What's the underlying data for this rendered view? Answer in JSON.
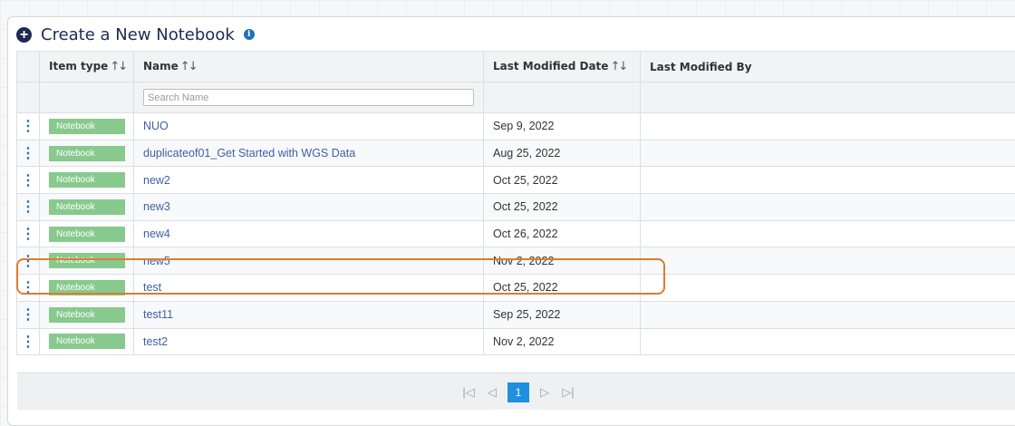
{
  "header": {
    "title": "Create a New Notebook",
    "add_icon": "plus-circle-icon",
    "info_icon": "info-icon"
  },
  "table": {
    "columns": [
      {
        "label": "Item type",
        "sortable": true
      },
      {
        "label": "Name",
        "sortable": true
      },
      {
        "label": "Last Modified Date",
        "sortable": true
      },
      {
        "label": "Last Modified By",
        "sortable": false
      }
    ],
    "search": {
      "placeholder": "Search Name",
      "value": ""
    },
    "rows": [
      {
        "type": "Notebook",
        "name": "NUO",
        "date": "Sep 9, 2022",
        "by": ""
      },
      {
        "type": "Notebook",
        "name": "duplicateof01_Get Started with WGS Data",
        "date": "Aug 25, 2022",
        "by": ""
      },
      {
        "type": "Notebook",
        "name": "new2",
        "date": "Oct 25, 2022",
        "by": ""
      },
      {
        "type": "Notebook",
        "name": "new3",
        "date": "Oct 25, 2022",
        "by": ""
      },
      {
        "type": "Notebook",
        "name": "new4",
        "date": "Oct 26, 2022",
        "by": ""
      },
      {
        "type": "Notebook",
        "name": "new5",
        "date": "Nov 2, 2022",
        "by": ""
      },
      {
        "type": "Notebook",
        "name": "test",
        "date": "Oct 25, 2022",
        "by": ""
      },
      {
        "type": "Notebook",
        "name": "test11",
        "date": "Sep 25, 2022",
        "by": ""
      },
      {
        "type": "Notebook",
        "name": "test2",
        "date": "Nov 2, 2022",
        "by": ""
      }
    ]
  },
  "pagination": {
    "current_page": "1"
  },
  "colors": {
    "accent": "#1f8fe0",
    "badge": "#88c98e",
    "highlight": "#e07b2f",
    "title": "#1e2a55"
  }
}
